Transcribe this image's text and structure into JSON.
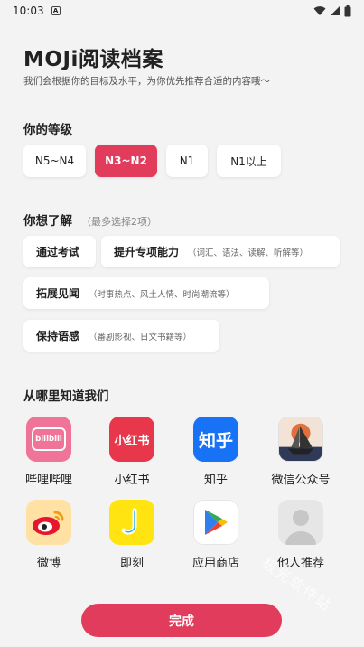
{
  "status_bar": {
    "time": "10:03"
  },
  "header": {
    "title": "MOJi阅读档案",
    "subtitle": "我们会根据你的目标及水平，为你优先推荐合适的内容哦～"
  },
  "level": {
    "title": "你的等级",
    "options": [
      "N5~N4",
      "N3~N2",
      "N1",
      "N1以上"
    ],
    "selected": "N3~N2"
  },
  "interests": {
    "title": "你想了解",
    "hint": "（最多选择2项）",
    "items": [
      {
        "label": "通过考试",
        "detail": ""
      },
      {
        "label": "提升专项能力",
        "detail": "（词汇、语法、读解、听解等）"
      },
      {
        "label": "拓展见闻",
        "detail": "（时事热点、风土人情、时尚潮流等）"
      },
      {
        "label": "保持语感",
        "detail": "（番剧影视、日文书籍等）"
      }
    ]
  },
  "sources": {
    "title": "从哪里知道我们",
    "items": [
      {
        "label": "哔哩哔哩",
        "icon": "bilibili-icon"
      },
      {
        "label": "小红书",
        "icon": "xiaohongshu-icon"
      },
      {
        "label": "知乎",
        "icon": "zhihu-icon"
      },
      {
        "label": "微信公众号",
        "icon": "wechat-official-account-icon"
      },
      {
        "label": "微博",
        "icon": "weibo-icon"
      },
      {
        "label": "即刻",
        "icon": "jike-icon"
      },
      {
        "label": "应用商店",
        "icon": "play-store-icon"
      },
      {
        "label": "他人推荐",
        "icon": "person-icon"
      }
    ]
  },
  "icon_text": {
    "bilibili": "bilibili",
    "xiaohongshu": "小红书",
    "zhihu": "知乎"
  },
  "done_label": "完成",
  "watermark": "极光软件站",
  "colors": {
    "accent": "#e23c5c",
    "background": "#f3f3f3"
  }
}
